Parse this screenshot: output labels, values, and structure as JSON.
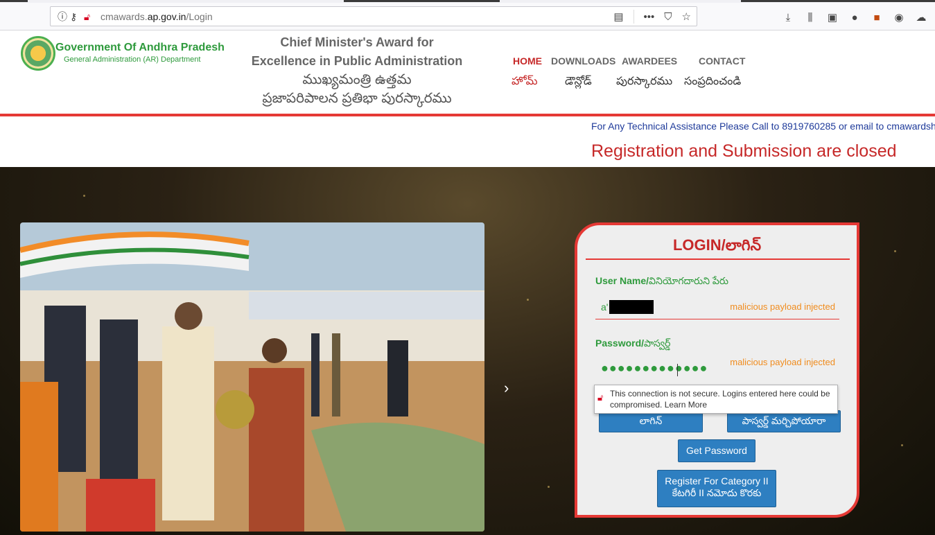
{
  "browser": {
    "url_prefix": "cmawards.",
    "url_domain": "ap.gov.in",
    "url_path": "/Login"
  },
  "header": {
    "gov_name": "Government Of Andhra Pradesh",
    "gov_dept": "General Administration (AR) Department",
    "award_line1": "Chief Minister's Award for",
    "award_line2": "Excellence in Public Administration",
    "award_te1": "ముఖ్యమంత్రి ఉత్తమ",
    "award_te2": "ప్రజాపరిపాలన ప్రతిభా పురస్కారము"
  },
  "nav": {
    "home": "HOME",
    "downloads": "DOWNLOADS",
    "awardees": "AWARDEES",
    "contact": "CONTACT",
    "home_te": "హోమ్",
    "downloads_te": "డౌన్లోడ్",
    "awardees_te": "పురస్కారము",
    "contact_te": "సంప్రదించండి"
  },
  "notice": {
    "marquee": "For Any Technical Assistance Please Call to 8919760285 or email to cmawardsh",
    "closed": "Registration and Submission are closed"
  },
  "login": {
    "title": "LOGIN/లాగిన్",
    "username_label": "User Name/",
    "username_label_te": "వినియోగదారుని పేరు",
    "username_value": "a'",
    "username_injected": "malicious payload injected",
    "password_label": "Password/",
    "password_label_te": "పాస్వర్డ్",
    "password_value": "●●●●●●●●●●●●●",
    "password_injected": "malicious payload injected",
    "login_button": "లాగిన్",
    "forgot_button": "పాస్వర్డ్ మర్చిపోయారా",
    "get_password": "Get Password",
    "register_line1": "Register For Category II",
    "register_line2": "కేటగిరీ II నమోదు కొరకు"
  },
  "security_warning": {
    "text": "This connection is not secure. Logins entered here could be compromised.",
    "learn_more": "Learn More"
  },
  "colors": {
    "accent_red": "#e53935",
    "brand_green": "#2e9a3c",
    "button_blue": "#2e7fc1"
  }
}
